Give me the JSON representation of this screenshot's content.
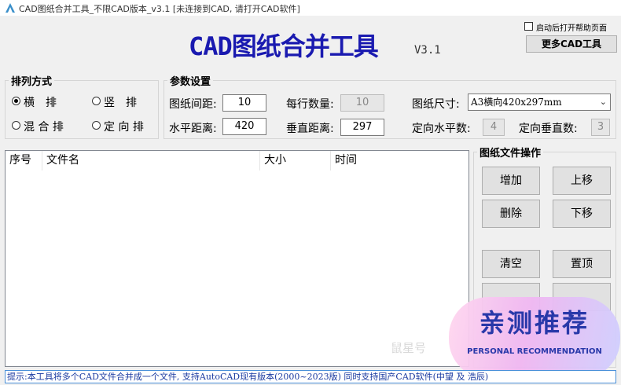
{
  "window": {
    "title": "CAD图纸合并工具_不限CAD版本_v3.1 [未连接到CAD, 请打开CAD软件]"
  },
  "header": {
    "app_title": "CAD图纸合并工具",
    "version": "V3.1",
    "help_checkbox_label": "启动后打开帮助页面",
    "help_checked": false,
    "more_tools_label": "更多CAD工具"
  },
  "arrangement": {
    "legend": "排列方式",
    "options": [
      {
        "label": "横　排",
        "selected": true
      },
      {
        "label": "竖　排",
        "selected": false
      },
      {
        "label": "混 合 排",
        "selected": false
      },
      {
        "label": "定 向 排",
        "selected": false
      }
    ]
  },
  "params": {
    "legend": "参数设置",
    "gap_label": "图纸间距:",
    "gap_value": "10",
    "per_row_label": "每行数量:",
    "per_row_value": "10",
    "size_label": "图纸尺寸:",
    "size_value": "A3横向420x297mm",
    "h_dist_label": "水平距离:",
    "h_dist_value": "420",
    "v_dist_label": "垂直距离:",
    "v_dist_value": "297",
    "dir_h_label": "定向水平数:",
    "dir_h_value": "4",
    "dir_v_label": "定向垂直数:",
    "dir_v_value": "3"
  },
  "file_list": {
    "columns": [
      "序号",
      "文件名",
      "大小",
      "时间"
    ],
    "rows": []
  },
  "operations": {
    "legend": "图纸文件操作",
    "add": "增加",
    "move_up": "上移",
    "delete": "删除",
    "move_down": "下移",
    "clear": "清空",
    "to_top": "置顶"
  },
  "status": {
    "text": "提示:本工具将多个CAD文件合并成一个文件, 支持AutoCAD现有版本(2000~2023版) 同时支持国产CAD软件(中望 及 浩辰)"
  },
  "overlay": {
    "watermark": "鼠星号",
    "badge_main": "亲测推荐",
    "badge_sub": "PERSONAL RECOMMENDATION"
  },
  "colors": {
    "title_blue": "#1a1ab0",
    "status_text": "#1a3aa0",
    "badge_text": "#1e2fa6"
  }
}
